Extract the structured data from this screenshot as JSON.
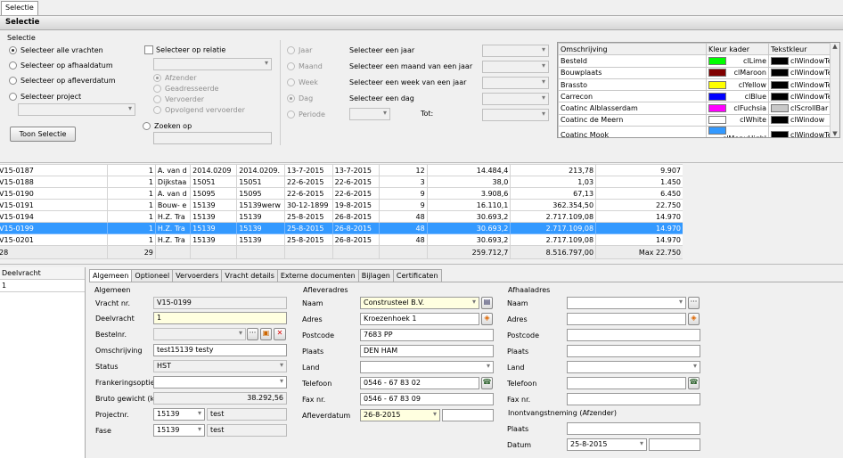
{
  "window_tab": "Selectie",
  "panel_title": "Selectie",
  "selectie": {
    "group_label": "Selectie",
    "radios": [
      "Selecteer alle vrachten",
      "Selecteer op afhaaldatum",
      "Selecteer op afleverdatum",
      "Selecteer project"
    ],
    "relatie_label": "Selecteer op relatie",
    "relatie_options": [
      "Afzender",
      "Geadresseerde",
      "Vervoerder",
      "Opvolgend vervoerder"
    ],
    "zoeken_label": "Zoeken op",
    "toon_button": "Toon Selectie",
    "period_radios": [
      "Jaar",
      "Maand",
      "Week",
      "Dag",
      "Periode"
    ],
    "period_texts": [
      "Selecteer een jaar",
      "Selecteer een maand van een jaar",
      "Selecteer een week van een jaar",
      "Selecteer een dag"
    ],
    "tot_label": "Tot:"
  },
  "kleuren": {
    "headers": [
      "Omschrijving",
      "Kleur kader",
      "Tekstkleur"
    ],
    "rows": [
      {
        "name": "Besteld",
        "kader": "clLime",
        "kader_color": "#00ff00",
        "tekst": "clWindowTe",
        "tekst_color": "#000000"
      },
      {
        "name": "Bouwplaats",
        "kader": "clMaroon",
        "kader_color": "#800000",
        "tekst": "clWindowTe",
        "tekst_color": "#000000"
      },
      {
        "name": "Brassto",
        "kader": "clYellow",
        "kader_color": "#ffff00",
        "tekst": "clWindowTe",
        "tekst_color": "#000000"
      },
      {
        "name": "Carrecon",
        "kader": "clBlue",
        "kader_color": "#0000ff",
        "tekst": "clWindowTe",
        "tekst_color": "#000000"
      },
      {
        "name": "Coatinc Alblasserdam",
        "kader": "clFuchsia",
        "kader_color": "#ff00ff",
        "tekst": "clScrollBar",
        "tekst_color": "#c8c8c8"
      },
      {
        "name": "Coatinc de Meern",
        "kader": "clWhite",
        "kader_color": "#ffffff",
        "tekst": "clWindow",
        "tekst_color": "#000000"
      },
      {
        "name": "Coatinc Mook",
        "kader": "clMenuHighl",
        "kader_color": "#3399ff",
        "tekst": "clWindowTe",
        "tekst_color": "#000000"
      }
    ]
  },
  "vrachten": {
    "rows": [
      [
        "V15-0187",
        "1",
        "A. van d",
        "2014.0209",
        "2014.0209.",
        "13-7-2015",
        "13-7-2015",
        "12",
        "14.484,4",
        "213,78",
        "9.907"
      ],
      [
        "V15-0188",
        "1",
        "Dijkstaa",
        "15051",
        "15051",
        "22-6-2015",
        "22-6-2015",
        "3",
        "38,0",
        "1,03",
        "1.450"
      ],
      [
        "V15-0190",
        "1",
        "A. van d",
        "15095",
        "15095",
        "22-6-2015",
        "22-6-2015",
        "9",
        "3.908,6",
        "67,13",
        "6.450"
      ],
      [
        "V15-0191",
        "1",
        "Bouw- e",
        "15139",
        "15139werw",
        "30-12-1899",
        "19-8-2015",
        "9",
        "16.110,1",
        "362.354,50",
        "22.750"
      ],
      [
        "V15-0194",
        "1",
        "H.Z. Tra",
        "15139",
        "15139",
        "25-8-2015",
        "26-8-2015",
        "48",
        "30.693,2",
        "2.717.109,08",
        "14.970"
      ],
      [
        "V15-0199",
        "1",
        "H.Z. Tra",
        "15139",
        "15139",
        "25-8-2015",
        "26-8-2015",
        "48",
        "30.693,2",
        "2.717.109,08",
        "14.970"
      ],
      [
        "V15-0201",
        "1",
        "H.Z. Tra",
        "15139",
        "15139",
        "25-8-2015",
        "26-8-2015",
        "48",
        "30.693,2",
        "2.717.109,08",
        "14.970"
      ]
    ],
    "selected_index": 5,
    "footer": {
      "count": "28",
      "sum_b": "29",
      "total_weight": "259.712,7",
      "total_amount": "8.516.797,00",
      "max": "Max 22.750"
    }
  },
  "deelvracht": {
    "header": "Deelvracht",
    "value": "1"
  },
  "detail_tabs": [
    "Algemeen",
    "Optioneel",
    "Vervoerders",
    "Vracht details",
    "Externe documenten",
    "Bijlagen",
    "Certificaten"
  ],
  "algemeen": {
    "title": "Algemeen",
    "vracht_nr_label": "Vracht nr.",
    "vracht_nr": "V15-0199",
    "deelvracht_label": "Deelvracht",
    "deelvracht": "1",
    "bestelnr_label": "Bestelnr.",
    "bestelnr": "",
    "omschrijving_label": "Omschrijving",
    "omschrijving": "test15139 testy",
    "status_label": "Status",
    "status": "HST",
    "frankering_label": "Frankeringsopties",
    "frankering": "",
    "bruto_label": "Bruto gewicht (kg)",
    "bruto": "38.292,56",
    "project_label": "Projectnr.",
    "project": "15139",
    "project_desc": "test",
    "fase_label": "Fase",
    "fase": "15139",
    "fase_desc": "test"
  },
  "aflever": {
    "title": "Afleveradres",
    "naam_label": "Naam",
    "naam": "Construsteel B.V.",
    "adres_label": "Adres",
    "adres": "Kroezenhoek 1",
    "postcode_label": "Postcode",
    "postcode": "7683 PP",
    "plaats_label": "Plaats",
    "plaats": "DEN HAM",
    "land_label": "Land",
    "land": "",
    "telefoon_label": "Telefoon",
    "telefoon": "0546 - 67 83 02",
    "fax_label": "Fax nr.",
    "fax": "0546 - 67 83 09",
    "datum_label": "Afleverdatum",
    "datum": "26-8-2015"
  },
  "afhaal": {
    "title": "Afhaaladres",
    "naam_label": "Naam",
    "adres_label": "Adres",
    "postcode_label": "Postcode",
    "plaats_label": "Plaats",
    "land_label": "Land",
    "telefoon_label": "Telefoon",
    "fax_label": "Fax nr.",
    "inontvangst_title": "Inontvangstneming (Afzender)",
    "io_plaats_label": "Plaats",
    "io_datum_label": "Datum",
    "io_datum": "25-8-2015"
  }
}
